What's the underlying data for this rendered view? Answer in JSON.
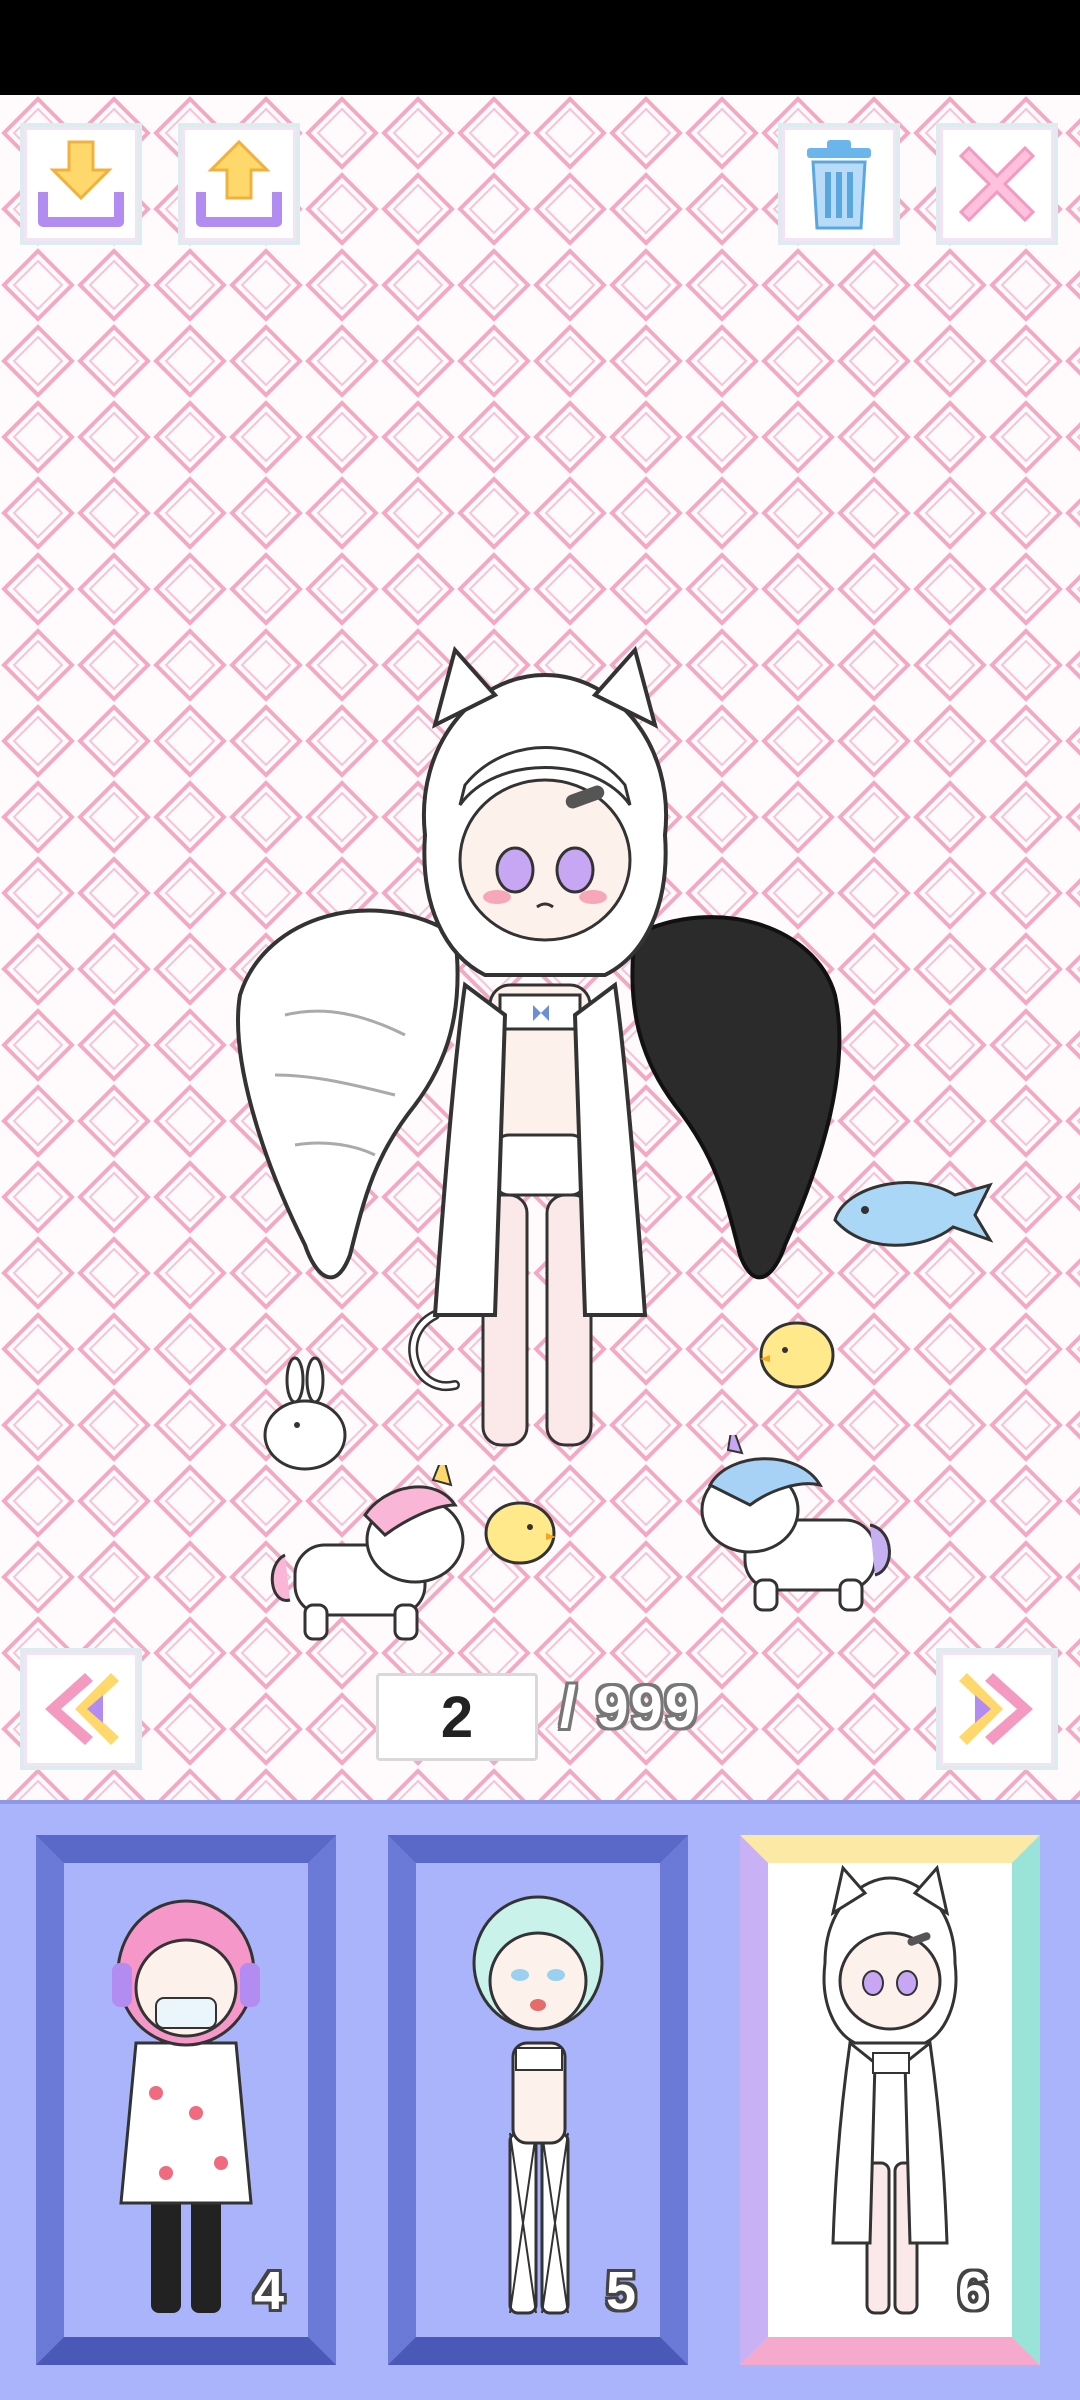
{
  "toolbar": {
    "save_icon": "download-arrow-icon",
    "load_icon": "upload-arrow-icon",
    "delete_icon": "trash-icon",
    "close_icon": "close-x-icon"
  },
  "pager": {
    "current": "2",
    "total": "/ 999",
    "prev_icon": "double-chevron-left-icon",
    "next_icon": "double-chevron-right-icon"
  },
  "slots": [
    {
      "number": "4",
      "selected": false
    },
    {
      "number": "5",
      "selected": false
    },
    {
      "number": "6",
      "selected": true
    }
  ],
  "colors": {
    "pattern": "#f3a9c4",
    "panel": "#a9b4fb",
    "slot_frame": "#6a7ad6",
    "accent_yellow": "#ffd86b",
    "accent_purple": "#b28cf0"
  }
}
